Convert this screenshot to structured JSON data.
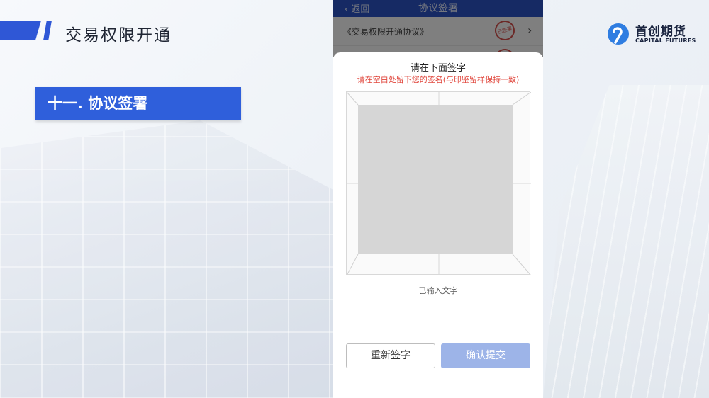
{
  "header": {
    "title": "交易权限开通"
  },
  "section": {
    "label": "十一. 协议签署"
  },
  "brand": {
    "name_cn": "首创期货",
    "name_en": "CAPITAL FUTURES",
    "icon": "capital-futures-logo"
  },
  "phone": {
    "nav": {
      "back_label": "返回",
      "title": "协议签署",
      "back_icon": "chevron-left-icon"
    },
    "agreements": [
      {
        "label": "《交易权限开通协议》",
        "stamp": "已签署"
      }
    ],
    "sheet": {
      "title": "请在下面签字",
      "hint": "请在空白处留下您的签名(与印鉴留样保持一致)",
      "caption": "已输入文字",
      "reset_label": "重新签字",
      "submit_label": "确认提交"
    }
  },
  "colors": {
    "accent": "#2f57d6",
    "nav": "#2d55c8",
    "hint": "#e0453b",
    "submit_disabled": "#9db4e8"
  }
}
